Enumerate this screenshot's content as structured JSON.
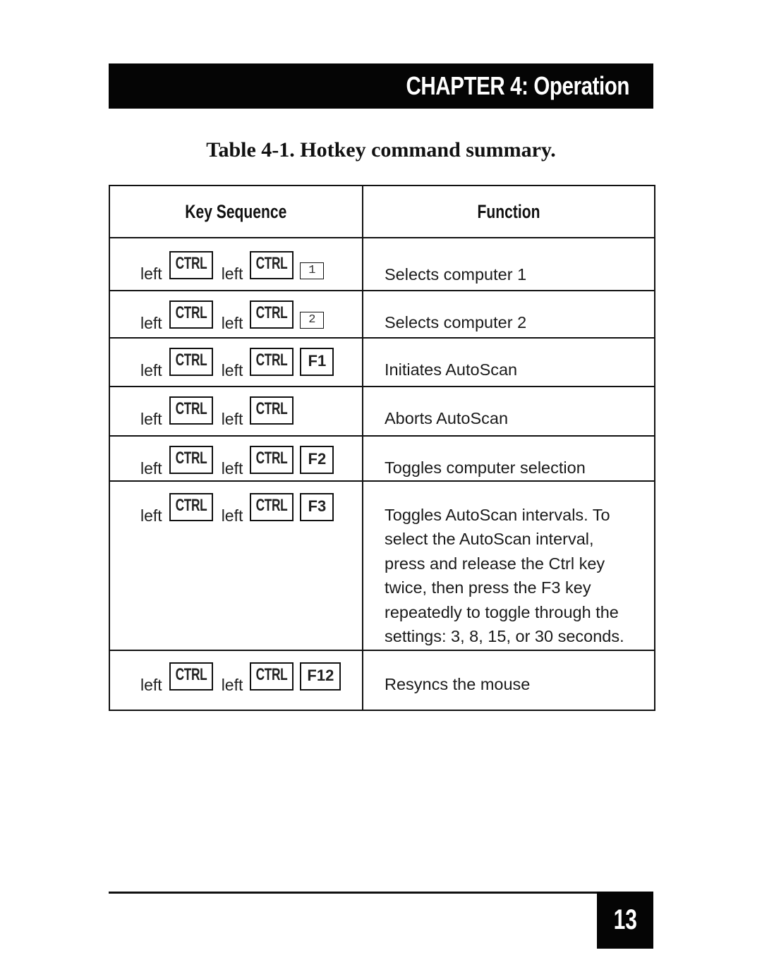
{
  "header": {
    "chapter_title": "CHAPTER 4: Operation"
  },
  "table": {
    "caption": "Table 4-1. Hotkey command summary.",
    "columns": [
      "Key Sequence",
      "Function"
    ],
    "rows": [
      {
        "keys": [
          "left",
          "CTRL",
          "left",
          "CTRL",
          "1"
        ],
        "final_key_style": "num",
        "function": "Selects computer 1"
      },
      {
        "keys": [
          "left",
          "CTRL",
          "left",
          "CTRL",
          "2"
        ],
        "final_key_style": "num",
        "function": "Selects computer 2"
      },
      {
        "keys": [
          "left",
          "CTRL",
          "left",
          "CTRL",
          "F1"
        ],
        "final_key_style": "fkey",
        "function": "Initiates AutoScan"
      },
      {
        "keys": [
          "left",
          "CTRL",
          "left",
          "CTRL",
          ""
        ],
        "final_key_style": "none",
        "function": "Aborts AutoScan"
      },
      {
        "keys": [
          "left",
          "CTRL",
          "left",
          "CTRL",
          "F2"
        ],
        "final_key_style": "fkey",
        "function": "Toggles computer selection"
      },
      {
        "keys": [
          "left",
          "CTRL",
          "left",
          "CTRL",
          "F3"
        ],
        "final_key_style": "fkey",
        "function_lines": [
          "Toggles AutoScan intervals. To",
          "select the AutoScan interval,",
          "press and release the Ctrl key",
          "twice, then press the F3 key",
          "repeatedly to toggle through the",
          "settings: 3, 8, 15, or 30 seconds."
        ]
      },
      {
        "keys": [
          "left",
          "CTRL",
          "left",
          "CTRL",
          "F12"
        ],
        "final_key_style": "fkey",
        "function": "Resyncs the mouse"
      }
    ]
  },
  "footer": {
    "page_number": "13"
  }
}
